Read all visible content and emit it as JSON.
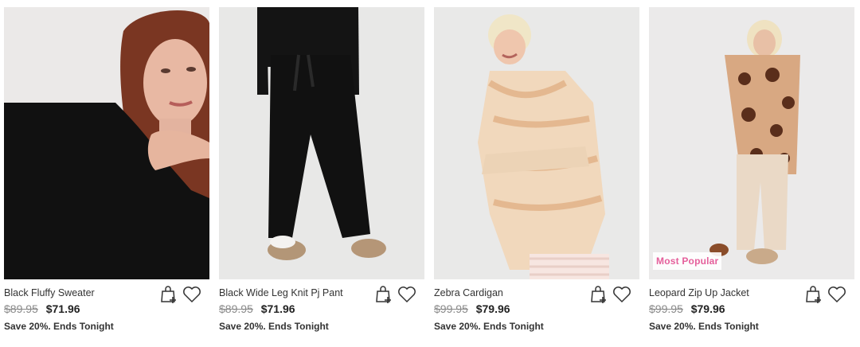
{
  "products": [
    {
      "title": "Black Fluffy Sweater",
      "was_price": "$89.95",
      "price": "$71.96",
      "promo": "Save 20%. Ends Tonight"
    },
    {
      "title": "Black Wide Leg Knit Pj Pant",
      "was_price": "$89.95",
      "price": "$71.96",
      "promo": "Save 20%. Ends Tonight"
    },
    {
      "title": "Zebra Cardigan",
      "was_price": "$99.95",
      "price": "$79.96",
      "promo": "Save 20%. Ends Tonight"
    },
    {
      "title": "Leopard Zip Up Jacket",
      "was_price": "$99.95",
      "price": "$79.96",
      "promo": "Save 20%. Ends Tonight",
      "badge": "Most Popular"
    }
  ],
  "icons": {
    "add_to_bag": "bag-plus-icon",
    "wishlist": "heart-icon"
  },
  "colors": {
    "badge_text": "#e55f9b",
    "strike_price": "#8a8a8a",
    "price": "#222222"
  }
}
